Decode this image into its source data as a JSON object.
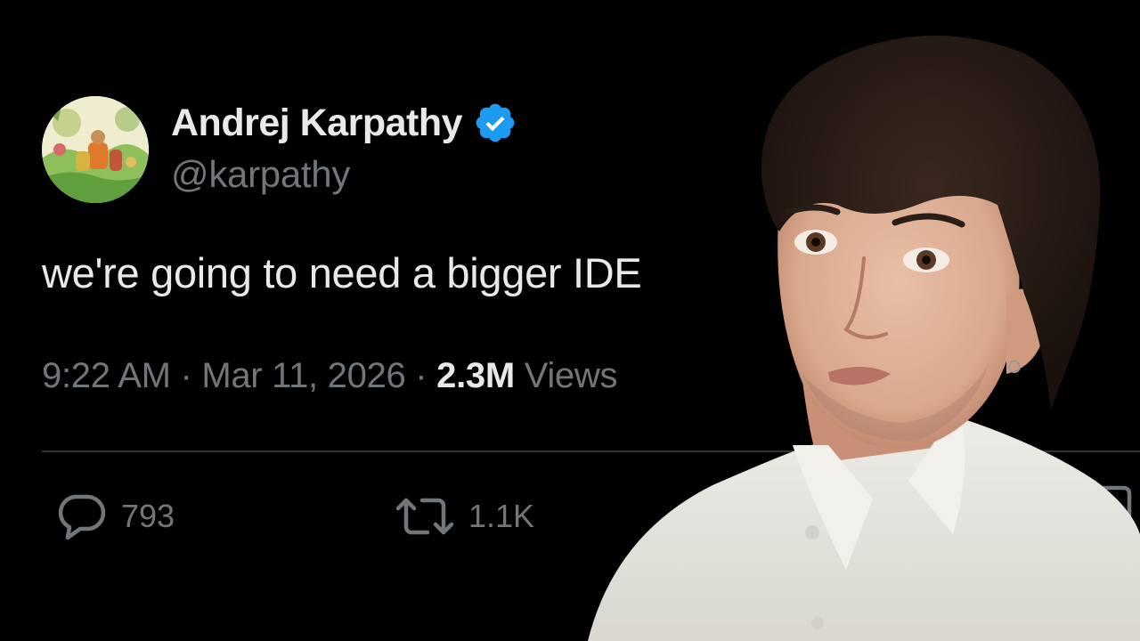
{
  "author": {
    "display_name": "Andrej Karpathy",
    "handle": "@karpathy",
    "verified": true,
    "avatar_icon": "illustrated-avatar-icon",
    "verified_icon": "verified-badge-icon"
  },
  "post": {
    "text": "we're going to need a bigger IDE",
    "time": "9:22 AM",
    "date": "Mar 11, 2026",
    "separator": " · ",
    "views_count": "2.3M",
    "views_label": "Views"
  },
  "actions": {
    "reply_count": "793",
    "repost_count": "1.1K",
    "reply_icon": "speech-bubble-icon",
    "repost_icon": "repost-arrows-icon"
  },
  "colors": {
    "background": "#000000",
    "primary_text": "#e7e9ea",
    "secondary_text": "#71767b",
    "verified_blue": "#1d9bf0",
    "divider": "#2f3336"
  }
}
